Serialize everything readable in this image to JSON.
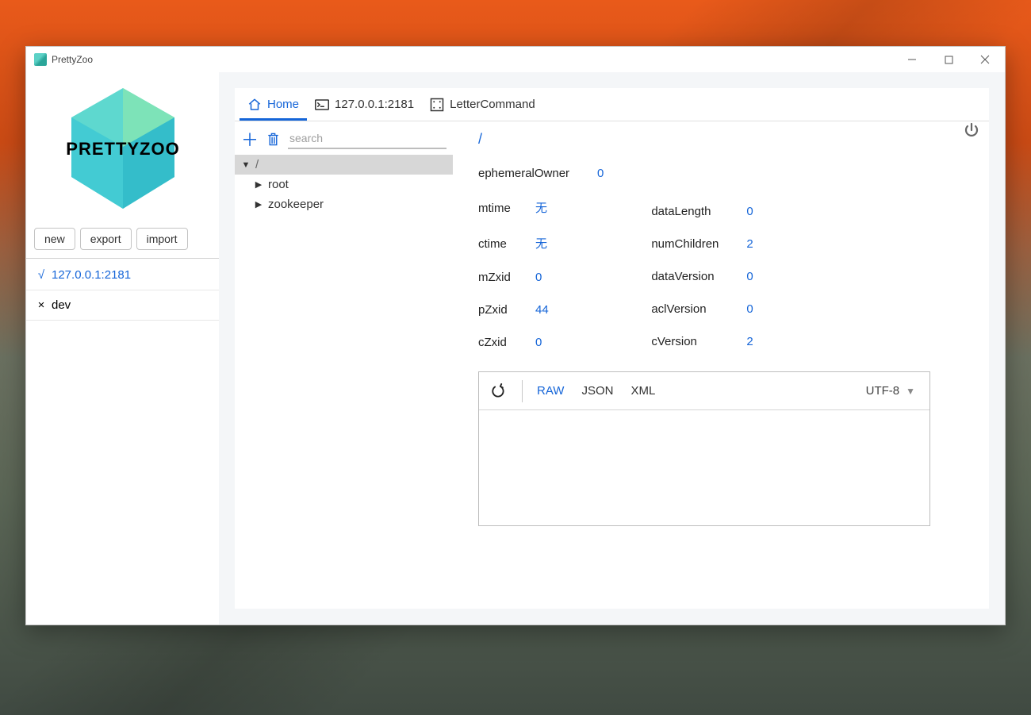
{
  "window": {
    "title": "PrettyZoo"
  },
  "sidebar": {
    "logo_text": "PRETTYZOO",
    "buttons": {
      "new": "new",
      "export": "export",
      "import": "import"
    },
    "servers": [
      {
        "name": "127.0.0.1:2181",
        "status_glyph": "√",
        "connected": true
      },
      {
        "name": "dev",
        "status_glyph": "×",
        "connected": false
      }
    ]
  },
  "tabs": {
    "home": "Home",
    "server": "127.0.0.1:2181",
    "letter": "LetterCommand"
  },
  "tree": {
    "search_placeholder": "search",
    "nodes": [
      {
        "label": "/",
        "expanded": true,
        "selected": true,
        "depth": 0
      },
      {
        "label": "root",
        "expanded": false,
        "selected": false,
        "depth": 1
      },
      {
        "label": "zookeeper",
        "expanded": false,
        "selected": false,
        "depth": 1
      }
    ]
  },
  "detail": {
    "path": "/",
    "stats_left": [
      {
        "key": "ephemeralOwner",
        "value": "0"
      },
      {
        "key": "mtime",
        "value": "无"
      },
      {
        "key": "ctime",
        "value": "无"
      },
      {
        "key": "mZxid",
        "value": "0"
      },
      {
        "key": "pZxid",
        "value": "44"
      },
      {
        "key": "cZxid",
        "value": "0"
      }
    ],
    "stats_right": [
      {
        "key": "dataLength",
        "value": "0"
      },
      {
        "key": "numChildren",
        "value": "2"
      },
      {
        "key": "dataVersion",
        "value": "0"
      },
      {
        "key": "aclVersion",
        "value": "0"
      },
      {
        "key": "cVersion",
        "value": "2"
      }
    ],
    "formats": {
      "raw": "RAW",
      "json": "JSON",
      "xml": "XML"
    },
    "encoding": "UTF-8"
  }
}
